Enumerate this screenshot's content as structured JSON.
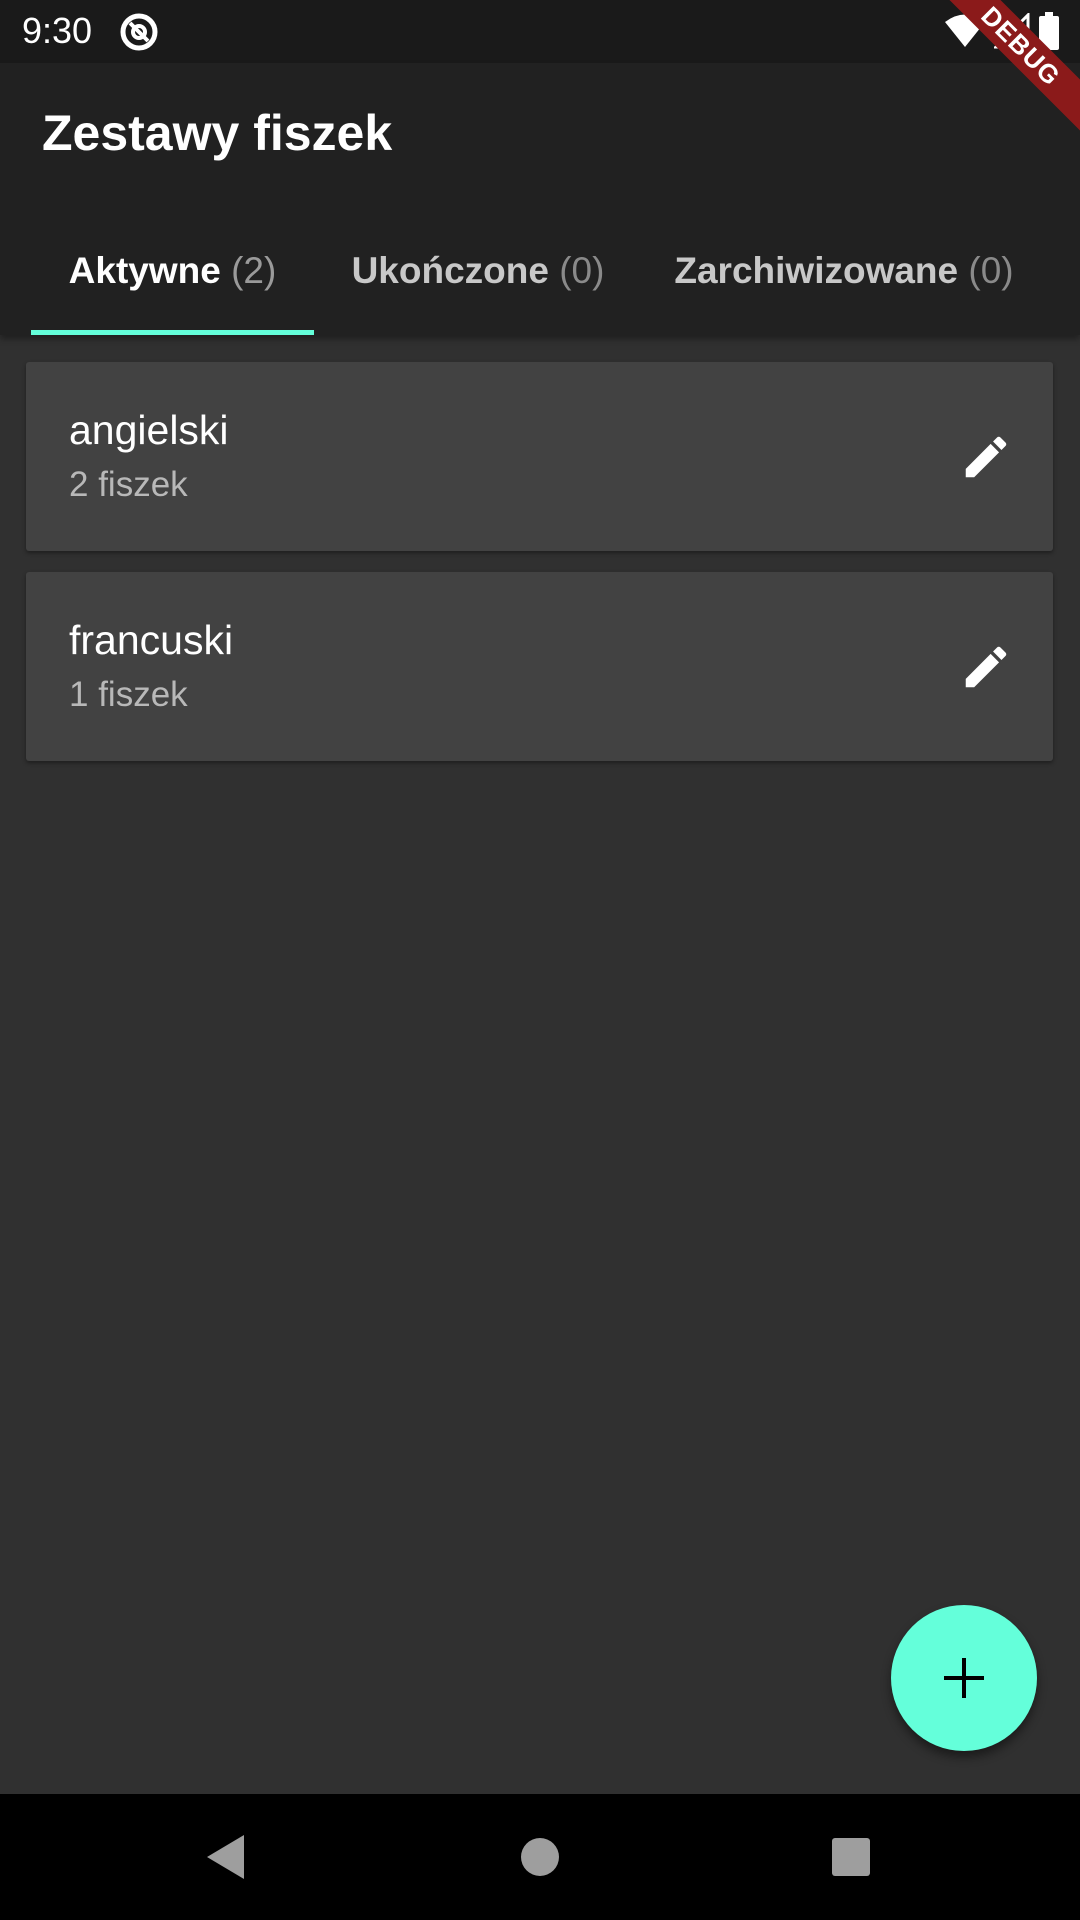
{
  "status_bar": {
    "time": "9:30",
    "debug_label": "DEBUG"
  },
  "app_bar": {
    "title": "Zestawy fiszek"
  },
  "tabs": [
    {
      "label": "Aktywne",
      "count": "(2)",
      "active": true
    },
    {
      "label": "Ukończone",
      "count": "(0)",
      "active": false
    },
    {
      "label": "Zarchiwizowane",
      "count": "(0)",
      "active": false
    }
  ],
  "sets": [
    {
      "name": "angielski",
      "count_label": "2 fiszek"
    },
    {
      "name": "francuski",
      "count_label": "1 fiszek"
    }
  ],
  "icons": {
    "edit": "pencil-icon",
    "fab": "plus-icon",
    "nav_back": "triangle-back-icon",
    "nav_home": "circle-home-icon",
    "nav_recents": "square-recents-icon"
  },
  "colors": {
    "accent": "#64ffda",
    "background": "#303030",
    "app_bar": "#212121",
    "card": "#424242",
    "debug_banner": "#8b1a1a"
  }
}
